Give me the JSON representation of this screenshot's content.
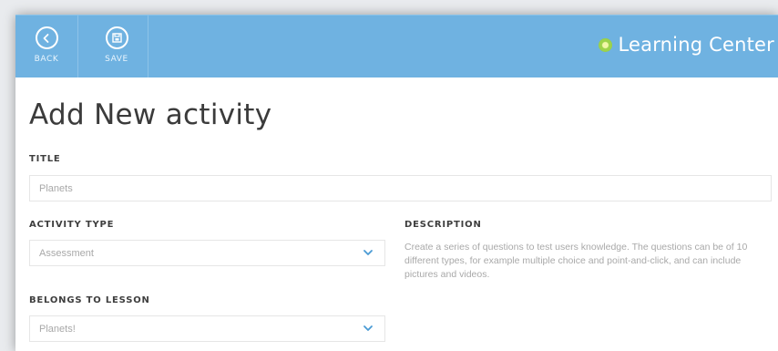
{
  "toolbar": {
    "back_label": "BACK",
    "save_label": "SAVE",
    "brand_name": "Learning Center",
    "bar_color": "#6fb2e1"
  },
  "page": {
    "title": "Add New activity"
  },
  "form": {
    "title_label": "TITLE",
    "title_value": "Planets",
    "activity_type_label": "ACTIVITY TYPE",
    "activity_type_value": "Assessment",
    "lesson_label": "BELONGS TO LESSON",
    "lesson_value": "Planets!",
    "description_label": "DESCRIPTION",
    "description_text": "Create a series of questions to test users knowledge. The questions can be of 10 different types, for example multiple choice and point-and-click, and can include pictures and videos."
  },
  "icons": {
    "back": "chevron-left-circle-icon",
    "save": "save-disk-icon",
    "brand": "learning-center-logo-icon",
    "dropdown": "chevron-down-icon"
  },
  "colors": {
    "accent": "#6fb2e1",
    "chevron": "#4a9ad4"
  }
}
